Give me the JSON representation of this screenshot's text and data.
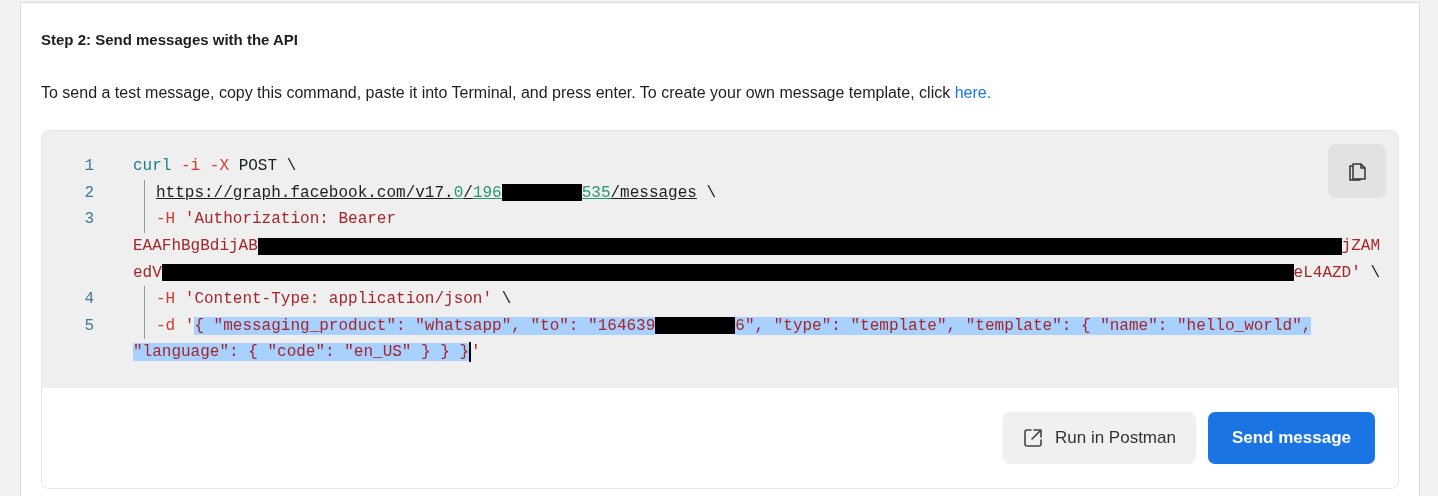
{
  "step": {
    "title": "Step 2: Send messages with the API",
    "description": "To send a test message, copy this command, paste it into Terminal, and press enter. To create your own message template, click ",
    "link": "here."
  },
  "code": {
    "lines": [
      {
        "number": "1",
        "indent": false,
        "segments": [
          {
            "text": "curl",
            "kind": "command",
            "selected": false
          },
          {
            "text": " -i",
            "kind": "flag",
            "selected": false
          },
          {
            "text": " -X",
            "kind": "flag",
            "selected": false
          },
          {
            "text": " POST \\",
            "kind": "plain",
            "selected": false
          }
        ]
      },
      {
        "number": "2",
        "indent": true,
        "segments": [
          {
            "text": "https://graph.facebook.com/v17.",
            "kind": "link",
            "selected": false
          },
          {
            "text": "0",
            "kind": "link-number",
            "selected": false
          },
          {
            "text": "/",
            "kind": "link",
            "selected": false
          },
          {
            "text": "196",
            "kind": "link-number",
            "selected": false
          },
          {
            "kind": "redacted"
          },
          {
            "text": "535",
            "kind": "link-number",
            "selected": false
          },
          {
            "text": "/messages",
            "kind": "link",
            "selected": false
          },
          {
            "text": " \\",
            "kind": "plain",
            "selected": false
          }
        ]
      },
      {
        "number": "3",
        "indent": true,
        "segments": [
          {
            "text": "-H",
            "kind": "flag",
            "selected": false
          },
          {
            "text": " 'Authorization: Bearer",
            "kind": "string",
            "selected": false
          }
        ]
      },
      {
        "indent": false,
        "segments": [
          {
            "text": "EAAFhBgBdijAB",
            "kind": "string",
            "selected": false
          },
          {
            "kind": "redacted"
          },
          {
            "text": "jZAM",
            "kind": "string",
            "selected": false
          }
        ]
      },
      {
        "indent": false,
        "segments": [
          {
            "text": "edV",
            "kind": "string",
            "selected": false
          },
          {
            "kind": "redacted"
          },
          {
            "text": "eL4AZD'",
            "kind": "string",
            "selected": false
          },
          {
            "text": " \\",
            "kind": "plain",
            "selected": false
          }
        ]
      },
      {
        "number": "4",
        "indent": true,
        "segments": [
          {
            "text": "-H",
            "kind": "flag",
            "selected": false
          },
          {
            "text": " 'Content-Type: application/json'",
            "kind": "string",
            "selected": false
          },
          {
            "text": " \\",
            "kind": "plain",
            "selected": false
          }
        ]
      },
      {
        "number": "5",
        "indent": true,
        "segments": [
          {
            "text": "-d",
            "kind": "flag",
            "selected": false
          },
          {
            "text": " '",
            "kind": "string",
            "selected": false
          },
          {
            "text": "{ \"messaging_product\": \"whatsapp\", \"to\": \"164639",
            "kind": "string",
            "selected": true
          },
          {
            "kind": "redacted"
          },
          {
            "text": "6\", \"type\": \"template\", \"template\": { \"name\": \"hello_world\",",
            "kind": "string",
            "selected": true
          }
        ]
      },
      {
        "indent": false,
        "segments": [
          {
            "text": "\"language\": { \"code\": \"en_US\" } } }",
            "kind": "string",
            "selected": true
          },
          {
            "kind": "cursor"
          },
          {
            "text": "'",
            "kind": "string",
            "selected": false
          }
        ]
      }
    ]
  },
  "buttons": [
    {
      "label": "Run in Postman",
      "kind": "secondary"
    },
    {
      "label": "Send message",
      "kind": "primary"
    }
  ]
}
